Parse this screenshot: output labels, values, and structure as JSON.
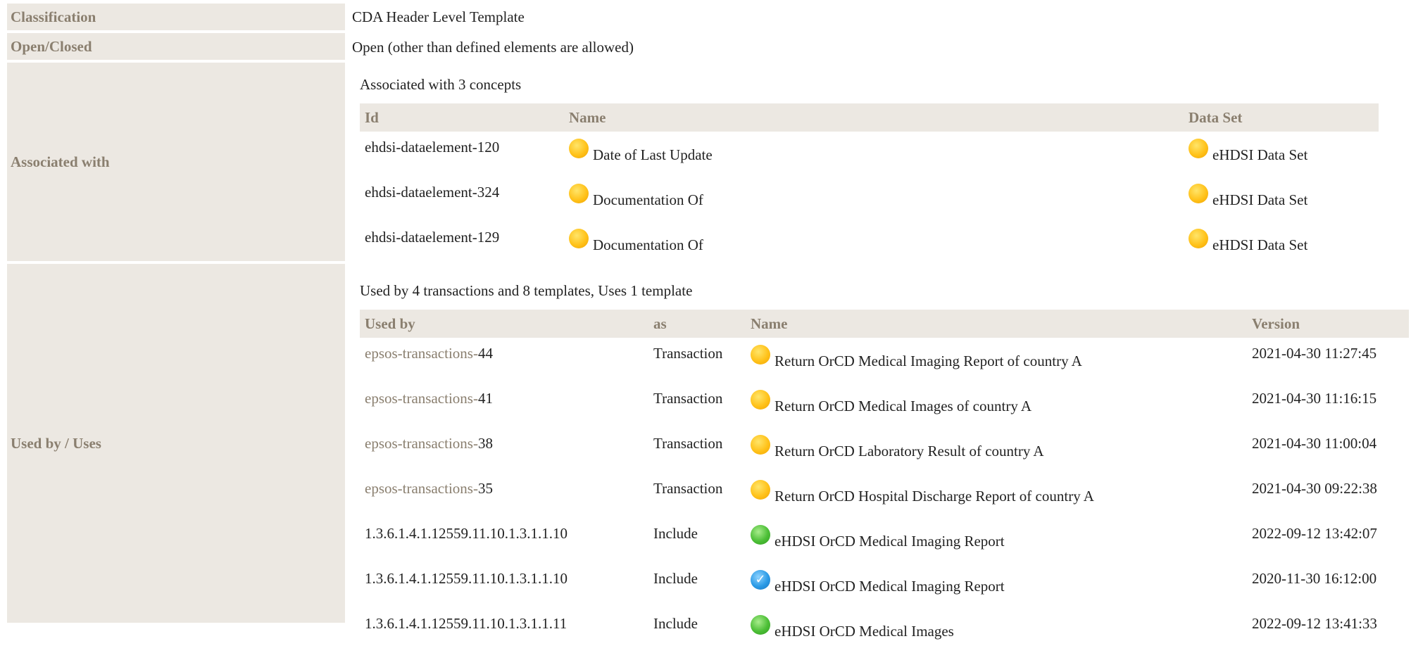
{
  "rows": {
    "classification": {
      "label": "Classification",
      "value": "CDA Header Level Template"
    },
    "open_closed": {
      "label": "Open/Closed",
      "value": "Open (other than defined elements are allowed)"
    },
    "associated_with": {
      "label": "Associated with",
      "summary": "Associated with 3 concepts",
      "columns": [
        "Id",
        "Name",
        "Data Set"
      ],
      "items": [
        {
          "id": "ehdsi-dataelement-120",
          "name": "Date of Last Update",
          "dataset": "eHDSI Data Set"
        },
        {
          "id": "ehdsi-dataelement-324",
          "name": "Documentation Of",
          "dataset": "eHDSI Data Set"
        },
        {
          "id": "ehdsi-dataelement-129",
          "name": "Documentation Of",
          "dataset": "eHDSI Data Set"
        }
      ]
    },
    "used_by": {
      "label": "Used by / Uses",
      "summary": "Used by 4 transactions and 8 templates, Uses 1 template",
      "columns": [
        "Used by",
        "as",
        "Name",
        "Version"
      ],
      "items": [
        {
          "used_by_prefix": "epsos-transactions-",
          "used_by_num": "44",
          "as": "Transaction",
          "icon": "yellow-status-icon",
          "name": "Return OrCD Medical Imaging Report of country A",
          "version": "2021-04-30 11:27:45"
        },
        {
          "used_by_prefix": "epsos-transactions-",
          "used_by_num": "41",
          "as": "Transaction",
          "icon": "yellow-status-icon",
          "name": "Return OrCD Medical Images of country A",
          "version": "2021-04-30 11:16:15"
        },
        {
          "used_by_prefix": "epsos-transactions-",
          "used_by_num": "38",
          "as": "Transaction",
          "icon": "yellow-status-icon",
          "name": "Return OrCD Laboratory Result of country A",
          "version": "2021-04-30 11:00:04"
        },
        {
          "used_by_prefix": "epsos-transactions-",
          "used_by_num": "35",
          "as": "Transaction",
          "icon": "yellow-status-icon",
          "name": "Return OrCD Hospital Discharge Report of country A",
          "version": "2021-04-30 09:22:38"
        },
        {
          "used_by": "1.3.6.1.4.1.12559.11.10.1.3.1.1.10",
          "as": "Include",
          "icon": "green-status-icon",
          "name": "eHDSI OrCD Medical Imaging Report",
          "version": "2022-09-12 13:42:07"
        },
        {
          "used_by": "1.3.6.1.4.1.12559.11.10.1.3.1.1.10",
          "as": "Include",
          "icon": "blue-check-icon",
          "name": "eHDSI OrCD Medical Imaging Report",
          "version": "2020-11-30 16:12:00"
        },
        {
          "used_by": "1.3.6.1.4.1.12559.11.10.1.3.1.1.11",
          "as": "Include",
          "icon": "green-status-icon",
          "name": "eHDSI OrCD Medical Images",
          "version": "2022-09-12 13:41:33"
        }
      ]
    }
  },
  "colors": {
    "label_bg": "#ece8e2",
    "label_text": "#8a7f6f",
    "muted_link": "#8a7f6f"
  }
}
